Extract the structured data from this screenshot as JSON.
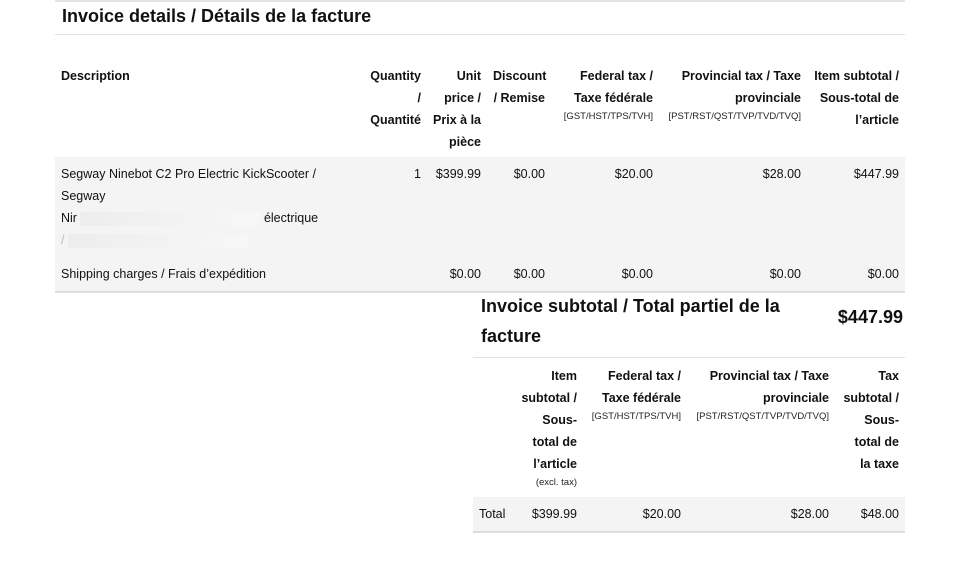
{
  "invoice": {
    "title": "Invoice details / Détails de la facture"
  },
  "items_table": {
    "headers": {
      "description": "Description",
      "quantity": "Quantity / Quantité",
      "unit_price": "Unit price / Prix à la pièce",
      "discount": "Discount / Remise",
      "federal_tax": "Federal tax / Taxe fédérale",
      "federal_tax_sub": "[GST/HST/TPS/TVH]",
      "provincial_tax": "Provincial tax / Taxe provinciale",
      "provincial_tax_sub": "[PST/RST/QST/TVP/TVD/TVQ]",
      "item_subtotal": "Item subtotal / Sous-total de l’article"
    },
    "rows": [
      {
        "description_line1": "Segway Ninebot C2 Pro Electric KickScooter / Segway",
        "description_line2_visible": "Nir",
        "description_line2_end": "électrique",
        "description_line3": "/",
        "quantity": "1",
        "unit_price": "$399.99",
        "discount": "$0.00",
        "federal_tax": "$20.00",
        "provincial_tax": "$28.00",
        "item_subtotal": "$447.99"
      },
      {
        "description_line1": "Shipping charges / Frais d’expédition",
        "quantity": "",
        "unit_price": "$0.00",
        "discount": "$0.00",
        "federal_tax": "$0.00",
        "provincial_tax": "$0.00",
        "item_subtotal": "$0.00"
      }
    ]
  },
  "subtotal": {
    "label": "Invoice subtotal / Total partiel de la facture",
    "value": "$447.99"
  },
  "tax_summary": {
    "headers": {
      "item_subtotal": "Item subtotal / Sous-total de l’article",
      "item_subtotal_sub": "(excl. tax)",
      "federal_tax": "Federal tax / Taxe fédérale",
      "federal_tax_sub": "[GST/HST/TPS/TVH]",
      "provincial_tax": "Provincial tax / Taxe provinciale",
      "provincial_tax_sub": "[PST/RST/QST/TVP/TVD/TVQ]",
      "tax_subtotal": "Tax subtotal / Sous-total de la taxe"
    },
    "total_row": {
      "label": "Total",
      "item_subtotal": "$399.99",
      "federal_tax": "$20.00",
      "provincial_tax": "$28.00",
      "tax_subtotal": "$48.00"
    }
  }
}
